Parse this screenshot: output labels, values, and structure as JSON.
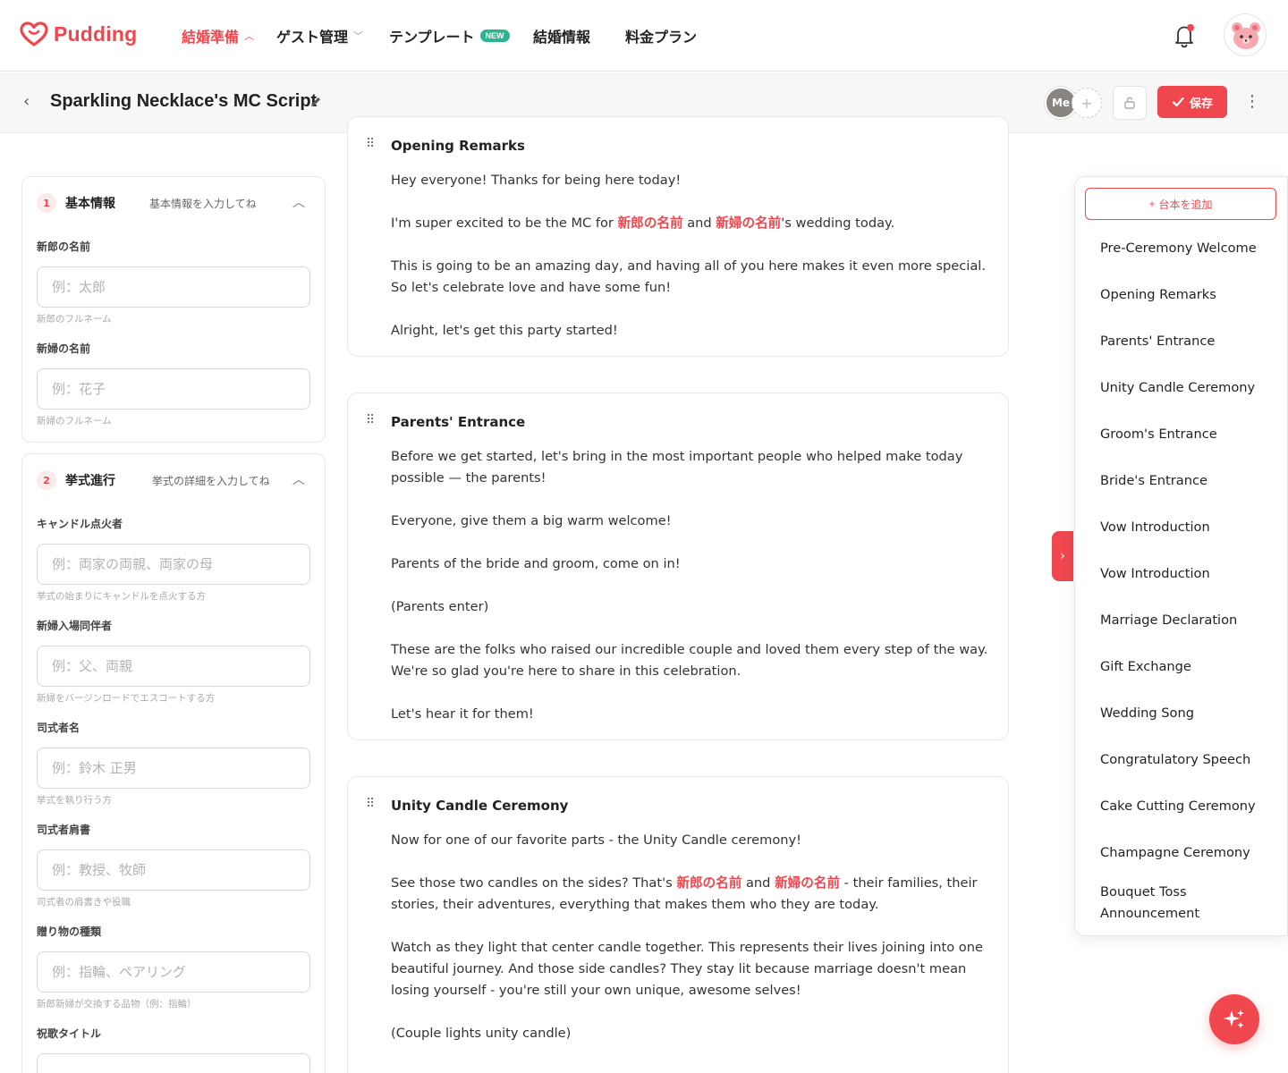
{
  "brand": {
    "name": "Pudding",
    "accent": "#f0474f"
  },
  "nav": {
    "items": [
      {
        "label": "結婚準備",
        "active": true
      },
      {
        "label": "ゲスト管理"
      },
      {
        "label": "テンプレート",
        "badge": "NEW"
      },
      {
        "label": "結婚情報"
      },
      {
        "label": "料金プラン"
      }
    ]
  },
  "titlebar": {
    "title": "Sparkling Necklace's MC Script",
    "me_label": "Me",
    "save_label": "保存"
  },
  "form": {
    "cards": [
      {
        "number": "1",
        "title": "基本情報",
        "subtitle": "基本情報を入力してね",
        "fields": [
          {
            "label": "新郎の名前",
            "placeholder": "例：太郎",
            "help": "新郎のフルネーム"
          },
          {
            "label": "新婦の名前",
            "placeholder": "例：花子",
            "help": "新婦のフルネーム"
          }
        ]
      },
      {
        "number": "2",
        "title": "挙式進行",
        "subtitle": "挙式の詳細を入力してね",
        "fields": [
          {
            "label": "キャンドル点火者",
            "placeholder": "例：両家の両親、両家の母",
            "help": "挙式の始まりにキャンドルを点火する方"
          },
          {
            "label": "新婦入場同伴者",
            "placeholder": "例：父、両親",
            "help": "新婦をバージンロードでエスコートする方"
          },
          {
            "label": "司式者名",
            "placeholder": "例：鈴木 正男",
            "help": "挙式を執り行う方"
          },
          {
            "label": "司式者肩書",
            "placeholder": "例：教授、牧師",
            "help": "司式者の肩書きや役職"
          },
          {
            "label": "贈り物の種類",
            "placeholder": "例：指輪、ペアリング",
            "help": "新郎新婦が交換する品物（例：指輪）"
          },
          {
            "label": "祝歌タイトル"
          }
        ]
      }
    ]
  },
  "script": {
    "groom_var": "新郎の名前",
    "bride_var": "新婦の名前",
    "sections": [
      {
        "title": "Opening Remarks",
        "lines": {
          "l1": "Hey everyone! Thanks for being here today!",
          "l2a": "I'm super excited to be the MC for ",
          "l2b": " and ",
          "l2c": "'s wedding today.",
          "l3": "This is going to be an amazing day, and having all of you here makes it even more special. So let's celebrate love and have some fun!",
          "l4": "Alright, let's get this party started!"
        }
      },
      {
        "title": "Parents' Entrance",
        "lines": {
          "l1": "Before we get started, let's bring in the most important people who helped make today possible — the parents!",
          "l2": "Everyone, give them a big warm welcome!",
          "l3": "Parents of the bride and groom, come on in!",
          "l4": "(Parents enter)",
          "l5": "These are the folks who raised our incredible couple and loved them every step of the way. We're so glad you're here to share in this celebration.",
          "l6": "Let's hear it for them!"
        }
      },
      {
        "title": "Unity Candle Ceremony",
        "lines": {
          "l1": "Now for one of our favorite parts - the Unity Candle ceremony!",
          "l2a": "See those two candles on the sides? That's ",
          "l2b": " and ",
          "l2c": " - their families, their stories, their adventures, everything that makes them who they are today.",
          "l3": "Watch as they light that center candle together. This represents their lives joining into one beautiful journey. And those side candles? They stay lit because marriage doesn't mean losing yourself - you're still your own unique, awesome selves!",
          "l4": "(Couple lights unity candle)"
        }
      }
    ]
  },
  "outline": {
    "add_label": "台本を追加",
    "items": [
      "Pre-Ceremony Welcome",
      "Opening Remarks",
      "Parents' Entrance",
      "Unity Candle Ceremony",
      "Groom's Entrance",
      "Bride's Entrance",
      "Vow Introduction",
      "Vow Introduction",
      "Marriage Declaration",
      "Gift Exchange",
      "Wedding Song",
      "Congratulatory Speech",
      "Cake Cutting Ceremony",
      "Champagne Ceremony",
      "Bouquet Toss Announcement"
    ]
  },
  "icons": {
    "logo": "heart-logo-icon",
    "bell": "bell-icon",
    "back": "chevron-left-icon",
    "edit": "pencil-icon",
    "lock": "unlock-icon",
    "save": "check-icon",
    "more": "more-vertical-icon",
    "drag": "drag-handle-icon",
    "fab": "ai-sparkle-icon"
  }
}
